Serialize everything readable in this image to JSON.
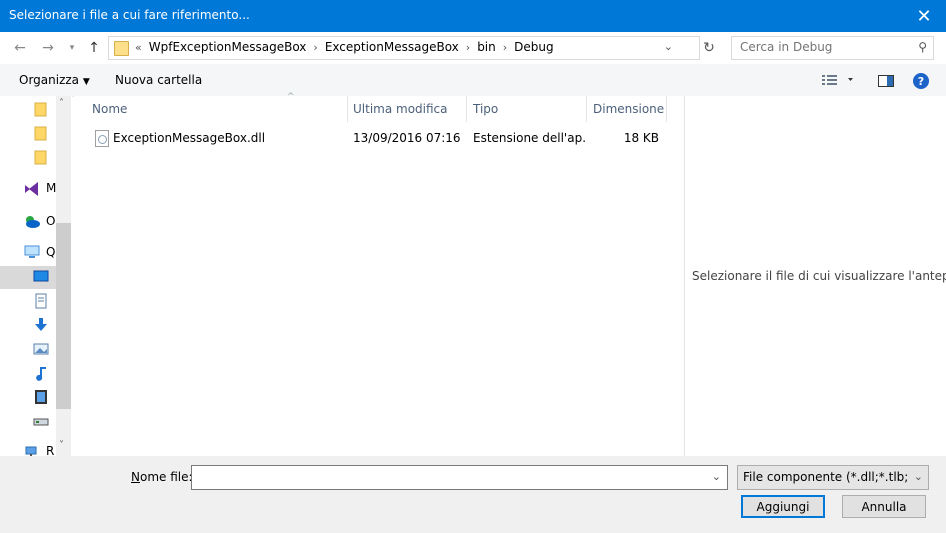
{
  "window": {
    "title": "Selezionare i file a cui fare riferimento..."
  },
  "address": {
    "prefix": "«",
    "crumbs": [
      "WpfExceptionMessageBox",
      "ExceptionMessageBox",
      "bin",
      "Debug"
    ]
  },
  "search": {
    "placeholder": "Cerca in Debug"
  },
  "toolbar": {
    "organize": "Organizza",
    "new_folder": "Nuova cartella"
  },
  "navpane": {
    "items": [
      {
        "icon": "folder-icon",
        "label": ""
      },
      {
        "icon": "folder-icon",
        "label": ""
      },
      {
        "icon": "folder-icon",
        "label": ""
      },
      {
        "icon": "visual-studio-icon",
        "label": "M"
      },
      {
        "icon": "onedrive-icon",
        "label": "O"
      },
      {
        "icon": "this-pc-icon",
        "label": "Q"
      },
      {
        "icon": "desktop-icon",
        "label": ""
      },
      {
        "icon": "documents-icon",
        "label": ""
      },
      {
        "icon": "downloads-icon",
        "label": ""
      },
      {
        "icon": "pictures-icon",
        "label": ""
      },
      {
        "icon": "music-icon",
        "label": ""
      },
      {
        "icon": "videos-icon",
        "label": ""
      },
      {
        "icon": "drive-icon",
        "label": ""
      },
      {
        "icon": "network-icon",
        "label": "R"
      }
    ]
  },
  "columns": {
    "name": "Nome",
    "modified": "Ultima modifica",
    "type": "Tipo",
    "size": "Dimensione"
  },
  "files": [
    {
      "name": "ExceptionMessageBox.dll",
      "modified": "13/09/2016 07:16",
      "type": "Estensione dell'ap...",
      "size": "18 KB"
    }
  ],
  "preview": {
    "text": "Selezionare il file di cui visualizzare l'anteprima."
  },
  "bottom": {
    "filename_label_underlined": "N",
    "filename_label_rest": "ome file:",
    "filename_value": "",
    "filter": "File componente (*.dll;*.tlb;*.oll",
    "add_button": "Aggiungi",
    "cancel_button": "Annulla"
  },
  "colors": {
    "titlebar": "#0078d7",
    "accent": "#0078d7"
  }
}
